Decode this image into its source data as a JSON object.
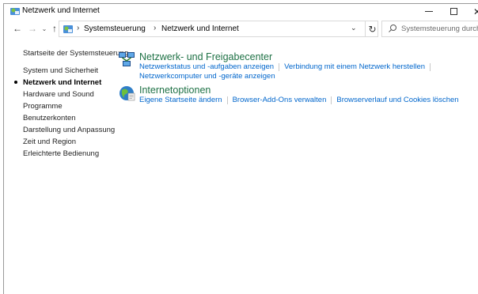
{
  "window": {
    "title": "Netzwerk und Internet",
    "controls": {
      "minimize": "",
      "maximize": "",
      "close": "✕"
    }
  },
  "navigation": {
    "back_icon": "←",
    "forward_icon": "→",
    "recent_icon": "⌄",
    "up_icon": "↑"
  },
  "address": {
    "breadcrumbs": [
      "Systemsteuerung",
      "Netzwerk und Internet"
    ],
    "separator": "›",
    "dropdown_icon": "⌄",
    "refresh_icon": "↻"
  },
  "search": {
    "placeholder": "Systemsteuerung durchsuchen"
  },
  "sidebar": {
    "items": [
      {
        "label": "Startseite der Systemsteuerung",
        "active": false
      },
      {
        "label": "System und Sicherheit",
        "active": false
      },
      {
        "label": "Netzwerk und Internet",
        "active": true
      },
      {
        "label": "Hardware und Sound",
        "active": false
      },
      {
        "label": "Programme",
        "active": false
      },
      {
        "label": "Benutzerkonten",
        "active": false
      },
      {
        "label": "Darstellung und Anpassung",
        "active": false
      },
      {
        "label": "Zeit und Region",
        "active": false
      },
      {
        "label": "Erleichterte Bedienung",
        "active": false
      }
    ]
  },
  "categories": [
    {
      "title": "Netzwerk- und Freigabecenter",
      "icon": "network-center-icon",
      "links_row1": [
        "Netzwerkstatus und -aufgaben anzeigen",
        "Verbindung mit einem Netzwerk herstellen"
      ],
      "links_row2": [
        "Netzwerkcomputer und -geräte anzeigen"
      ]
    },
    {
      "title": "Internetoptionen",
      "icon": "internet-options-icon",
      "links_row1": [
        "Eigene Startseite ändern",
        "Browser-Add-Ons verwalten",
        "Browserverlauf und Cookies löschen"
      ]
    }
  ],
  "colors": {
    "category_title": "#1e7145",
    "link": "#0066cc"
  }
}
